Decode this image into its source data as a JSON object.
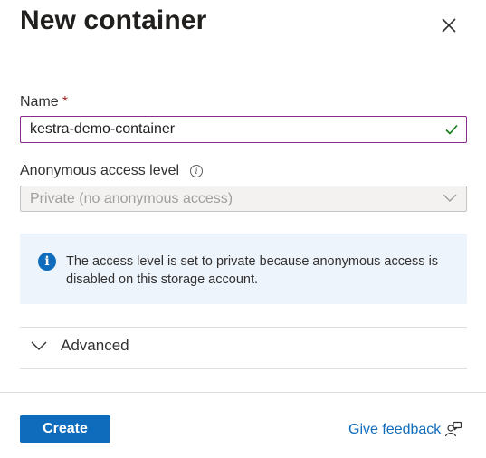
{
  "panel": {
    "title": "New container",
    "close_icon": "close-icon"
  },
  "name_field": {
    "label": "Name",
    "required_marker": "*",
    "value": "kestra-demo-container",
    "valid_icon": "checkmark-icon"
  },
  "access_level": {
    "label": "Anonymous access level",
    "info_icon": "info-icon",
    "selected": "Private (no anonymous access)",
    "disabled": true
  },
  "info_message": {
    "icon": "info-icon",
    "text": "The access level is set to private because anonymous access is disabled on this storage account."
  },
  "advanced": {
    "label": "Advanced",
    "expanded": false
  },
  "footer": {
    "create_label": "Create",
    "feedback_label": "Give feedback",
    "feedback_icon": "feedback-icon"
  },
  "colors": {
    "primary": "#0f6cbd",
    "required": "#a4262c",
    "focus_border": "#8a2a8a",
    "success": "#107c10",
    "info_bg": "#eef4fc"
  }
}
